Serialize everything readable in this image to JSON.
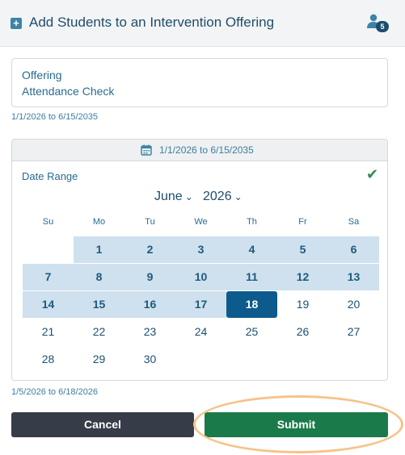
{
  "header": {
    "add_icon": "+",
    "title": "Add Students to an Intervention Offering",
    "people_badge": "5"
  },
  "offering": {
    "label": "Offering",
    "value": "Attendance Check",
    "range": "1/1/2026 to 6/15/2035"
  },
  "calendar": {
    "bar_text": "1/1/2026 to 6/15/2035",
    "date_range_label": "Date Range",
    "check": "✔",
    "month": "June",
    "year": "2026",
    "weekdays": [
      "Su",
      "Mo",
      "Tu",
      "We",
      "Th",
      "Fr",
      "Sa"
    ],
    "weeks": [
      [
        "",
        "1",
        "2",
        "3",
        "4",
        "5",
        "6"
      ],
      [
        "7",
        "8",
        "9",
        "10",
        "11",
        "12",
        "13"
      ],
      [
        "14",
        "15",
        "16",
        "17",
        "18",
        "19",
        "20"
      ],
      [
        "21",
        "22",
        "23",
        "24",
        "25",
        "26",
        "27"
      ],
      [
        "28",
        "29",
        "30",
        "",
        "",
        "",
        ""
      ]
    ],
    "range_start_day": 1,
    "selected_day": 18
  },
  "selected_range": "1/5/2026 to 6/18/2026",
  "buttons": {
    "cancel": "Cancel",
    "submit": "Submit"
  },
  "colors": {
    "submit": "#1b7a4a",
    "cancel": "#363d48",
    "in_range": "#cfe1ee",
    "selected": "#0d5b8c",
    "highlight": "#f5c48a"
  }
}
